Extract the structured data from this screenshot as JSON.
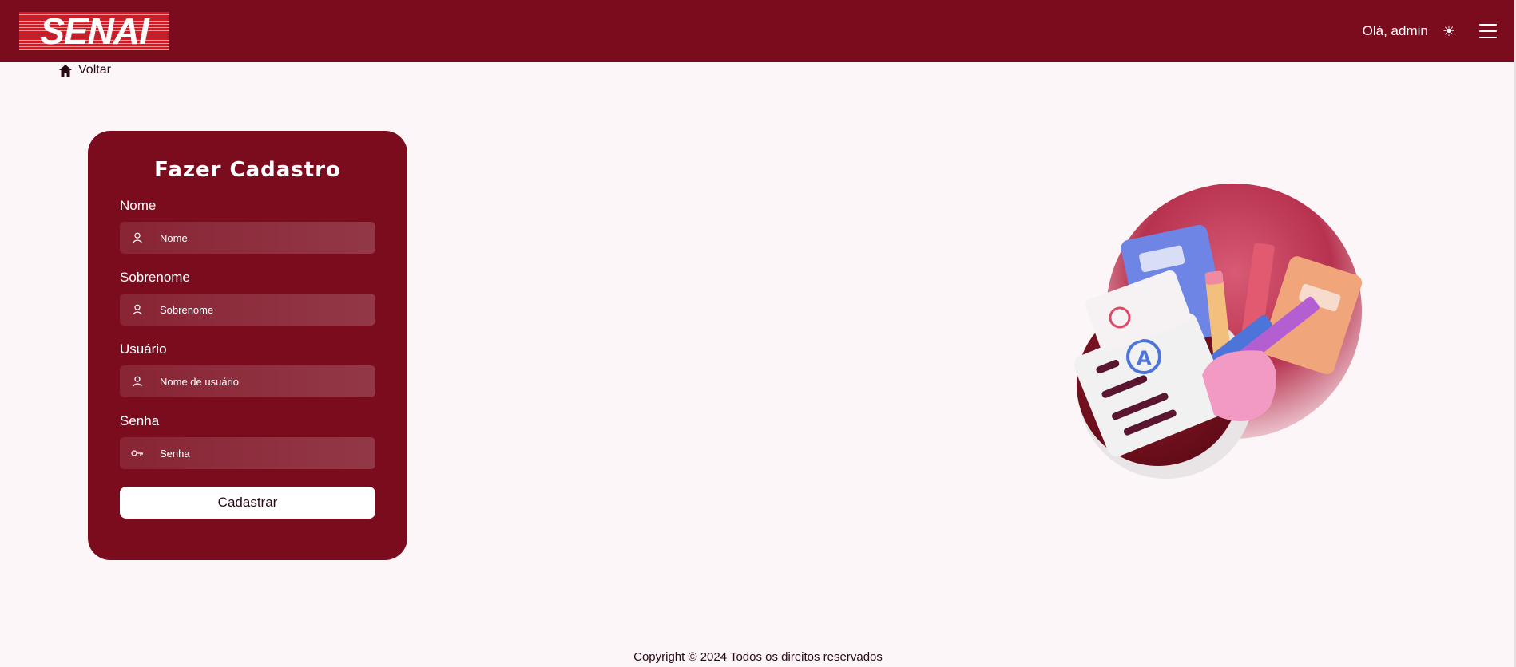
{
  "header": {
    "logo_text": "SENAI",
    "greeting": "Olá, admin",
    "theme_icon": "sun-icon",
    "menu_icon": "hamburger-menu-icon"
  },
  "back": {
    "label": "Voltar",
    "icon": "home-icon"
  },
  "form": {
    "title": "Fazer Cadastro",
    "fields": [
      {
        "label": "Nome",
        "placeholder": "Nome",
        "icon": "user-icon"
      },
      {
        "label": "Sobrenome",
        "placeholder": "Sobrenome",
        "icon": "user-icon"
      },
      {
        "label": "Usuário",
        "placeholder": "Nome de usuário",
        "icon": "user-icon"
      },
      {
        "label": "Senha",
        "placeholder": "Senha",
        "icon": "key-icon"
      }
    ],
    "submit_label": "Cadastrar"
  },
  "footer": {
    "copyright": "Copyright © 2024 Todos os direitos reservados"
  },
  "colors": {
    "brand": "#7b0c1e",
    "logo_red": "#e3121f",
    "background": "#fdf6f8"
  }
}
